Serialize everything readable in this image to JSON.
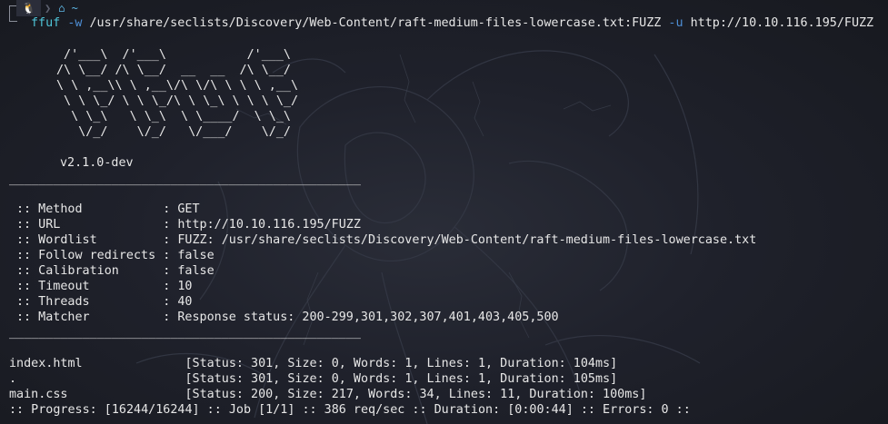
{
  "prompt": {
    "os_icon": "tux-icon",
    "home_symbol": "~"
  },
  "command": {
    "program": "ffuf",
    "flag_w": "-w",
    "wordlist": "/usr/share/seclists/Discovery/Web-Content/raft-medium-files-lowercase.txt:FUZZ",
    "flag_u": "-u",
    "url": "http://10.10.116.195/FUZZ"
  },
  "banner": [
    " /'___\\  /'___\\           /'___\\",
    "/\\ \\__/ /\\ \\__/  __  __  /\\ \\__/",
    "\\ \\ ,__\\\\ \\ ,__\\/\\ \\/\\ \\ \\ \\ ,__\\",
    " \\ \\ \\_/ \\ \\ \\_/\\ \\ \\_\\ \\ \\ \\ \\_/",
    "  \\ \\_\\   \\ \\_\\  \\ \\____/  \\ \\_\\",
    "   \\/_/    \\/_/   \\/___/    \\/_/"
  ],
  "version": "v2.1.0-dev",
  "rule": "________________________________________________",
  "config": [
    {
      "key": ":: Method           ",
      "value": ": GET"
    },
    {
      "key": ":: URL              ",
      "value": ": http://10.10.116.195/FUZZ"
    },
    {
      "key": ":: Wordlist         ",
      "value": ": FUZZ: /usr/share/seclists/Discovery/Web-Content/raft-medium-files-lowercase.txt"
    },
    {
      "key": ":: Follow redirects ",
      "value": ": false"
    },
    {
      "key": ":: Calibration      ",
      "value": ": false"
    },
    {
      "key": ":: Timeout          ",
      "value": ": 10"
    },
    {
      "key": ":: Threads          ",
      "value": ": 40"
    },
    {
      "key": ":: Matcher          ",
      "value": ": Response status: 200-299,301,302,307,401,403,405,500"
    }
  ],
  "results": [
    {
      "name": "index.html              ",
      "info": "[Status: 301, Size: 0, Words: 1, Lines: 1, Duration: 104ms]"
    },
    {
      "name": ".                       ",
      "info": "[Status: 301, Size: 0, Words: 1, Lines: 1, Duration: 105ms]"
    },
    {
      "name": "main.css                ",
      "info": "[Status: 200, Size: 217, Words: 34, Lines: 11, Duration: 100ms]"
    }
  ],
  "progress": ":: Progress: [16244/16244] :: Job [1/1] :: 386 req/sec :: Duration: [0:00:44] :: Errors: 0 ::"
}
